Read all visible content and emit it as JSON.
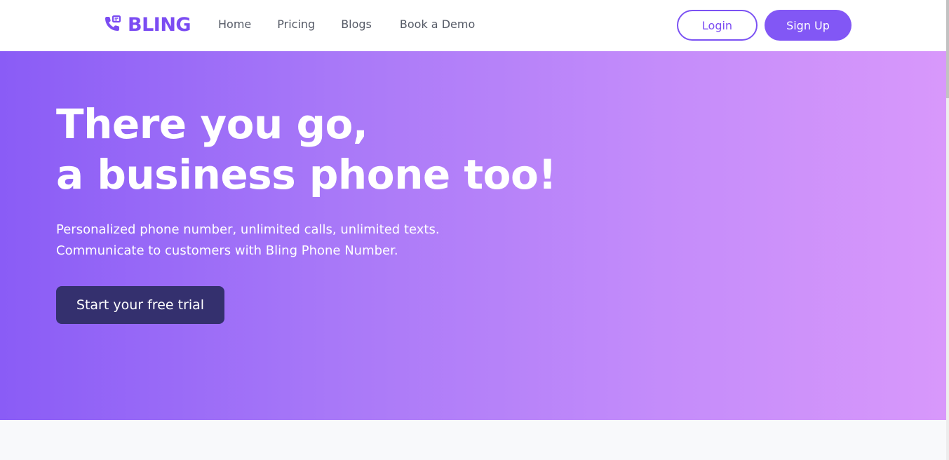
{
  "brand": {
    "name": "BLING",
    "icon": "phone-call-icon",
    "color": "#7b4cf2"
  },
  "nav": {
    "links": [
      {
        "label": "Home"
      },
      {
        "label": "Pricing"
      },
      {
        "label": "Blogs"
      },
      {
        "label": "Book a Demo"
      }
    ],
    "login_label": "Login",
    "signup_label": "Sign Up"
  },
  "hero": {
    "title_line1": "There you go,",
    "title_line2": "a business phone too!",
    "subtitle_line1": "Personalized phone number, unlimited calls, unlimited texts.",
    "subtitle_line2": "Communicate to customers with Bling Phone Number.",
    "cta_label": "Start your free trial",
    "gradient_start": "#8a5cf6",
    "gradient_end": "#d898fb",
    "cta_color": "#34306e"
  }
}
